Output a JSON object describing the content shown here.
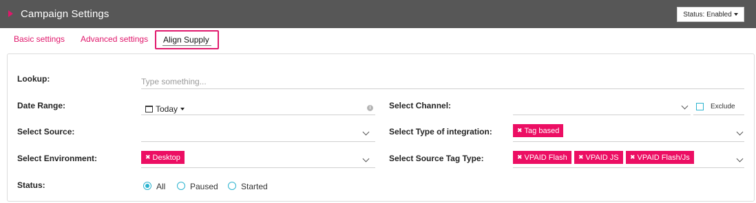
{
  "header": {
    "title": "Campaign Settings",
    "status_button": "Status: Enabled"
  },
  "tabs": [
    {
      "label": "Basic settings"
    },
    {
      "label": "Advanced settings"
    },
    {
      "label": "Align Supply"
    }
  ],
  "form": {
    "lookup": {
      "label": "Lookup:",
      "placeholder": "Type something..."
    },
    "date_range": {
      "label": "Date Range:",
      "value": "Today"
    },
    "select_channel": {
      "label": "Select Channel:",
      "exclude_label": "Exclude"
    },
    "select_source": {
      "label": "Select Source:"
    },
    "select_integration": {
      "label": "Select Type of integration:",
      "tags": [
        "Tag based"
      ]
    },
    "select_environment": {
      "label": "Select Environment:",
      "tags": [
        "Desktop"
      ]
    },
    "select_source_tag_type": {
      "label": "Select Source Tag Type:",
      "tags": [
        "VPAID Flash",
        "VPAID JS",
        "VPAID Flash/Js"
      ]
    },
    "status": {
      "label": "Status:",
      "options": [
        "All",
        "Paused",
        "Started"
      ],
      "selected": "All"
    }
  },
  "colors": {
    "accent": "#e0176b",
    "header_bg": "#575757",
    "radio": "#2bb3cf"
  }
}
